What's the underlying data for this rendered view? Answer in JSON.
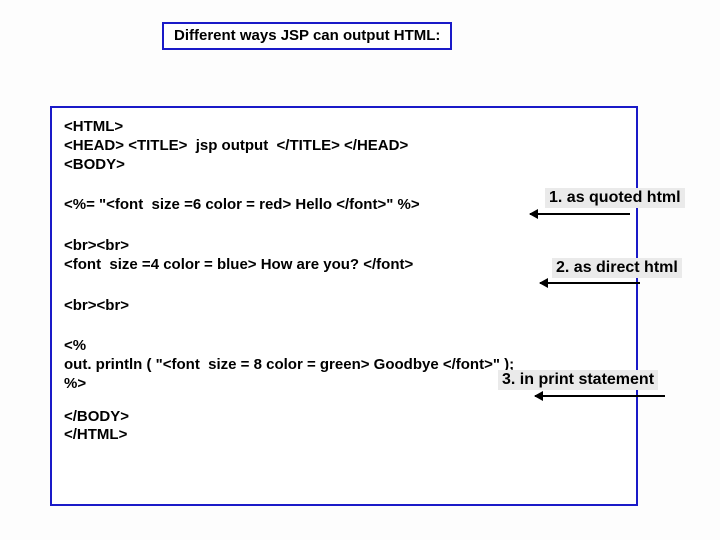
{
  "title": "Different ways JSP can output HTML:",
  "code": {
    "l1": "<HTML>",
    "l2": "<HEAD> <TITLE>  jsp output  </TITLE> </HEAD>",
    "l3": "<BODY>",
    "l4": "<%= \"<font  size =6 color = red> Hello </font>\" %>",
    "l5": "<br><br>",
    "l6": "<font  size =4 color = blue> How are you? </font>",
    "l7": "<br><br>",
    "l8": "<%",
    "l9": "out. println ( \"<font  size = 8 color = green> Goodbye </font>\" );",
    "l10": "%>",
    "l11": "</BODY>",
    "l12": "</HTML>"
  },
  "labels": {
    "one": "1. as quoted html",
    "two": "2. as direct html",
    "three": "3. in print statement"
  }
}
